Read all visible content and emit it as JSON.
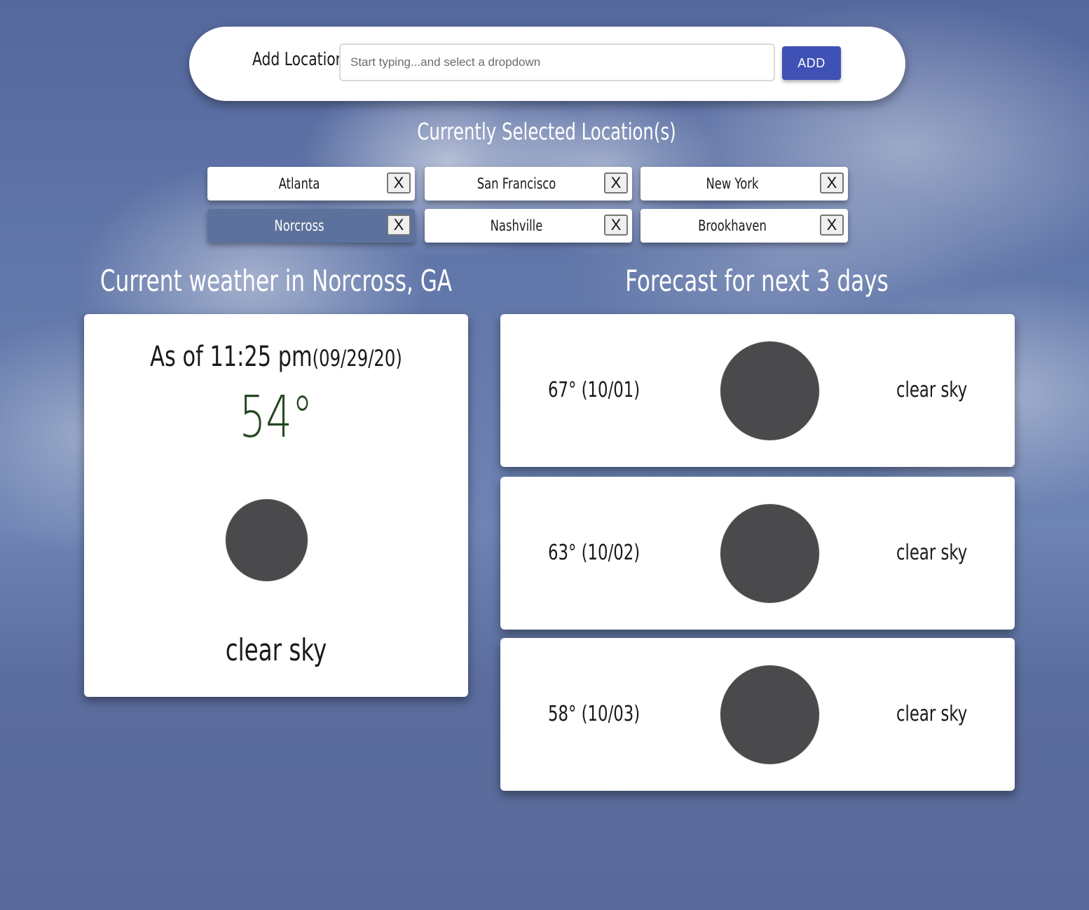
{
  "add_location": {
    "label": "Add Location",
    "input_value": "",
    "placeholder": "Start typing...and select a dropdown",
    "button_label": "ADD",
    "button_color": "#3f51b5"
  },
  "selected_locations": {
    "title": "Currently Selected Location(s)",
    "remove_label": "X",
    "selected_color": "#5c729c",
    "items": [
      {
        "label": "Atlanta",
        "selected": false
      },
      {
        "label": "San Francisco",
        "selected": false
      },
      {
        "label": "New York",
        "selected": false
      },
      {
        "label": "Norcross",
        "selected": true
      },
      {
        "label": "Nashville",
        "selected": false
      },
      {
        "label": "Brookhaven",
        "selected": false
      }
    ]
  },
  "current_weather": {
    "title": "Current weather in Norcross, GA",
    "as_of_prefix": "As of 11:25 pm",
    "as_of_date": "(09/29/20)",
    "temperature": "54°",
    "temperature_color": "#23461f",
    "icon": "weather-icon-circle",
    "description": "clear sky"
  },
  "forecast": {
    "title": "Forecast for next 3 days",
    "days": [
      {
        "temp_date": "67° (10/01)",
        "icon": "weather-icon-circle",
        "description": "clear sky"
      },
      {
        "temp_date": "63° (10/02)",
        "icon": "weather-icon-circle",
        "description": "clear sky"
      },
      {
        "temp_date": "58° (10/03)",
        "icon": "weather-icon-circle",
        "description": "clear sky"
      }
    ]
  }
}
